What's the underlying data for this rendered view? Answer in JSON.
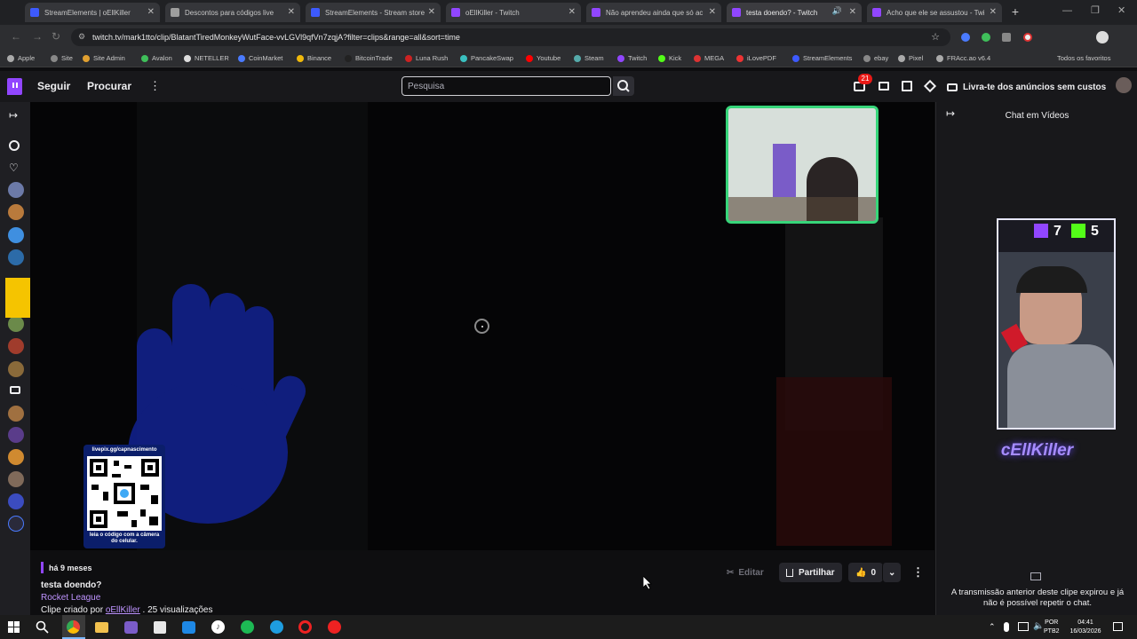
{
  "browser": {
    "tabs": [
      {
        "title": "StreamElements | oEllKiller",
        "color": "#3d5afe"
      },
      {
        "title": "Descontos para códigos live",
        "color": "#9e9e9e"
      },
      {
        "title": "StreamElements - Stream store",
        "color": "#3d5afe"
      },
      {
        "title": "oEllKiller - Twitch",
        "color": "#9146ff"
      },
      {
        "title": "Não aprendeu ainda que só ac",
        "color": "#9146ff"
      },
      {
        "title": "testa doendo? - Twitch",
        "color": "#9146ff"
      },
      {
        "title": "Acho que ele se assustou - Twi",
        "color": "#9146ff"
      }
    ],
    "url": "twitch.tv/mark1tto/clip/BlatantTiredMonkeyWutFace-vvLGVl9qfVn7zqjA?filter=clips&range=all&sort=time",
    "bookmarks": [
      "Apple",
      "Site",
      "Site Admin",
      "Avalon",
      "NETELLER",
      "CoinMarket",
      "Binance",
      "BitcoinTrade",
      "Luna Rush",
      "PancakeSwap",
      "Youtube",
      "Steam",
      "Twitch",
      "Kick",
      "MEGA",
      "iLovePDF",
      "StreamElements",
      "ebay",
      "Pixel",
      "FRAcc.ao v6.4"
    ],
    "all_favorites": "Todos os favoritos"
  },
  "nav": {
    "following": "Seguir",
    "browse": "Procurar",
    "search_placeholder": "Pesquisa",
    "notification_count": "21",
    "ad_free": "Livra-te dos anúncios sem custos"
  },
  "player": {
    "qr_url": "livepix.gg/capnascimento",
    "qr_caption": "leia o código com a câmera do celular.",
    "overlay_counts": {
      "twitch": "7",
      "kick": "5"
    },
    "overlay_name": "cEllKiller"
  },
  "clip": {
    "time_ago": "há 9 meses",
    "title": "testa doendo?",
    "game": "Rocket League",
    "created_by_prefix": "Clipe criado por",
    "creator": "oEllKiller",
    "views": ". 25 visualizações",
    "edit_label": "Editar",
    "share_label": "Partilhar",
    "likes": "0"
  },
  "chat": {
    "title": "Chat em Vídeos",
    "expired_message": "A transmissão anterior deste clipe expirou e já não é possível repetir o chat."
  },
  "taskbar": {
    "lang_top": "POR",
    "lang_bottom": "PTB2",
    "time": "04:41",
    "date": "16/03/2026"
  },
  "colors": {
    "twitch_purple": "#9146ff",
    "link_purple": "#bf94ff",
    "yellow_box": "#f5c400",
    "webcam_border": "#37d67a"
  }
}
